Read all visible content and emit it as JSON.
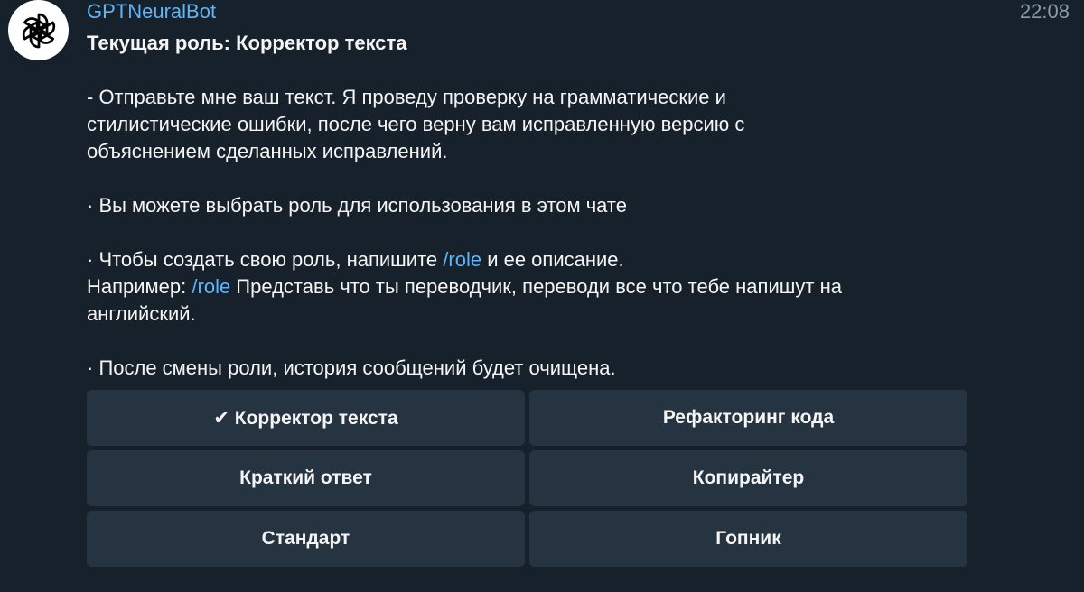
{
  "avatar": {
    "icon": "openai-logo-icon",
    "background": "#ffffff"
  },
  "message": {
    "sender": "GPTNeuralBot",
    "time": "22:08",
    "title": "Текущая роль: Корректор текста",
    "para1": "- Отправьте мне ваш текст. Я проведу проверку на грамматические и\nстилистические ошибки, после чего верну вам исправленную версию с\nобъяснением сделанных исправлений.",
    "para2": "· Вы можете выбрать роль для использования в этом чате",
    "para3_before": "· Чтобы создать свою роль, напишите ",
    "para3_cmd": "/role",
    "para3_after": " и ее описание.",
    "para3_line2_before": "Например: ",
    "para3_line2_cmd": "/role",
    "para3_line2_after": " Представь что ты переводчик, переводи все что тебе напишут на\nанглийский.",
    "para4": "· После смены роли, история сообщений будет очищена."
  },
  "keyboard": {
    "buttons": [
      {
        "label": "✔ Корректор текста"
      },
      {
        "label": "Рефакторинг кода"
      },
      {
        "label": "Краткий ответ"
      },
      {
        "label": "Копирайтер"
      },
      {
        "label": "Стандарт"
      },
      {
        "label": "Гопник"
      }
    ]
  },
  "colors": {
    "background": "#17212b",
    "accent": "#5eb5f7",
    "button": "#263442",
    "time": "#8d9ba8"
  }
}
